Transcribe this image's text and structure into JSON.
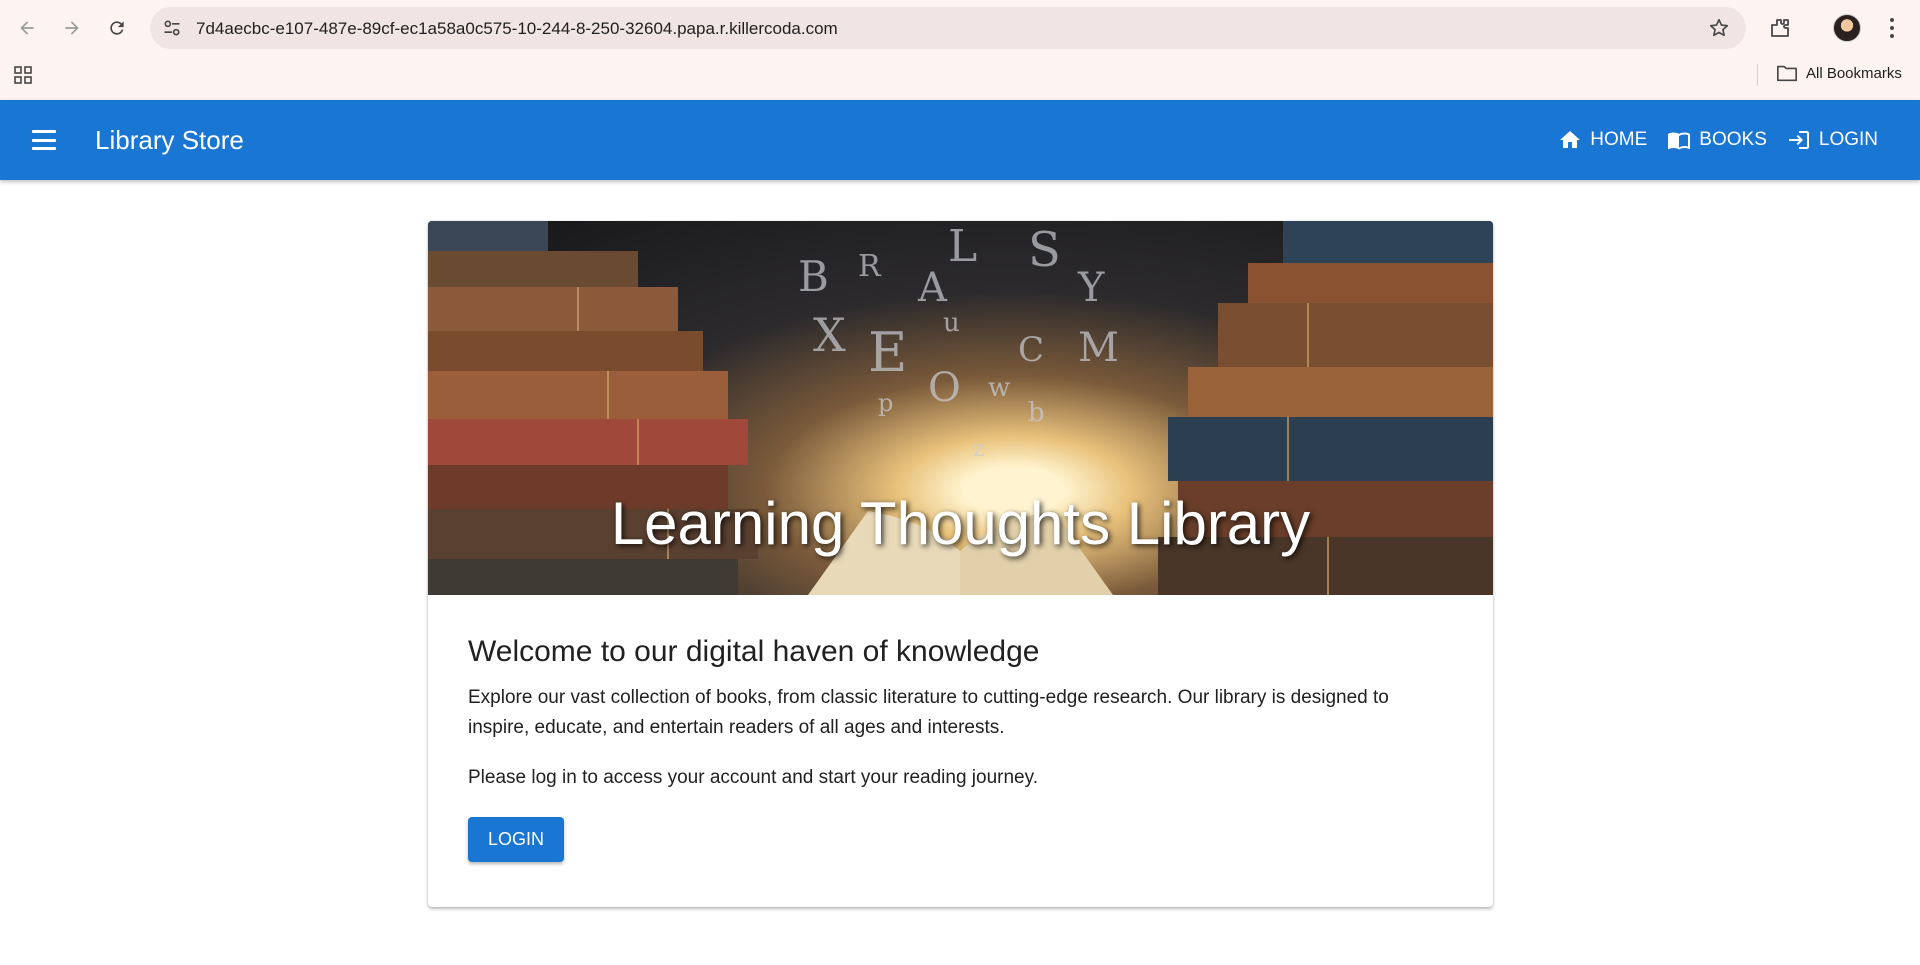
{
  "browser": {
    "url": "7d4aecbc-e107-487e-89cf-ec1a58a0c575-10-244-8-250-32604.papa.r.killercoda.com",
    "bookmarks_label": "All Bookmarks",
    "icons": [
      "back-arrow-icon",
      "forward-arrow-icon",
      "reload-icon",
      "site-settings-icon",
      "bookmark-star-icon",
      "extensions-icon",
      "profile-avatar",
      "kebab-menu-icon",
      "apps-grid-icon",
      "folder-icon"
    ]
  },
  "app_bar": {
    "title": "Library Store",
    "nav": [
      {
        "label": "HOME",
        "icon": "home-icon"
      },
      {
        "label": "BOOKS",
        "icon": "book-icon"
      },
      {
        "label": "LOGIN",
        "icon": "login-icon"
      }
    ],
    "color": "#1976d2"
  },
  "hero": {
    "title": "Learning Thoughts Library",
    "image": "old books with flying letters"
  },
  "main": {
    "heading": "Welcome to our digital haven of knowledge",
    "paragraph1": "Explore our vast collection of books, from classic literature to cutting-edge research. Our library is designed to inspire, educate, and entertain readers of all ages and interests.",
    "paragraph2": "Please log in to access your account and start your reading journey.",
    "login_button": "LOGIN"
  }
}
